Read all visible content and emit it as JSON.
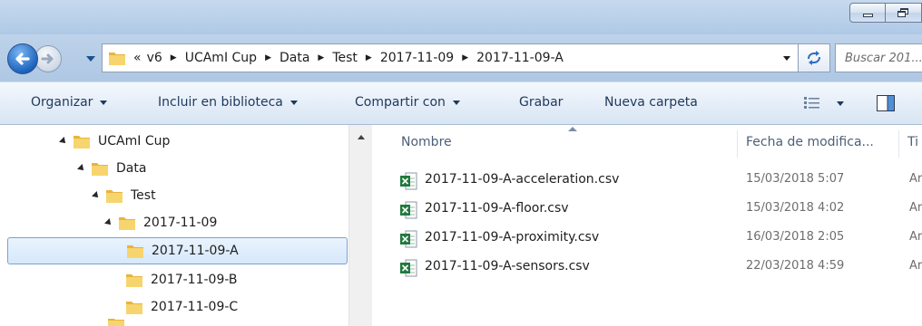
{
  "window": {
    "controls": {
      "minimize_icon": "minimize-icon",
      "restore_icon": "restore-icon"
    }
  },
  "address_bar": {
    "overflow_chevron": "«",
    "breadcrumbs": [
      "v6",
      "UCAmI Cup",
      "Data",
      "Test",
      "2017-11-09",
      "2017-11-09-A"
    ],
    "search_placeholder": "Buscar 201..."
  },
  "toolbar": {
    "organize": "Organizar",
    "include_library": "Incluir en biblioteca",
    "share_with": "Compartir con",
    "burn": "Grabar",
    "new_folder": "Nueva carpeta"
  },
  "nav_tree": [
    {
      "label": "UCAmI Cup",
      "expanded": true,
      "selected": false
    },
    {
      "label": "Data",
      "expanded": true,
      "selected": false
    },
    {
      "label": "Test",
      "expanded": true,
      "selected": false
    },
    {
      "label": "2017-11-09",
      "expanded": true,
      "selected": false
    },
    {
      "label": "2017-11-09-A",
      "expanded": false,
      "selected": true
    },
    {
      "label": "2017-11-09-B",
      "expanded": false,
      "selected": false
    },
    {
      "label": "2017-11-09-C",
      "expanded": false,
      "selected": false
    }
  ],
  "columns": {
    "name": "Nombre",
    "date_modified": "Fecha de modifica...",
    "type": "Ti"
  },
  "files": [
    {
      "name": "2017-11-09-A-acceleration.csv",
      "date": "15/03/2018 5:07",
      "type": "Ar"
    },
    {
      "name": "2017-11-09-A-floor.csv",
      "date": "15/03/2018 4:02",
      "type": "Ar"
    },
    {
      "name": "2017-11-09-A-proximity.csv",
      "date": "16/03/2018 2:05",
      "type": "Ar"
    },
    {
      "name": "2017-11-09-A-sensors.csv",
      "date": "22/03/2018 4:59",
      "type": "Ar"
    }
  ],
  "colors": {
    "selection_border": "#7da2ce",
    "selection_fill": "#d6e8fb",
    "toolbar_text": "#1e395b",
    "folder_yellow": "#f2c94c",
    "excel_green": "#1f7a3d"
  }
}
